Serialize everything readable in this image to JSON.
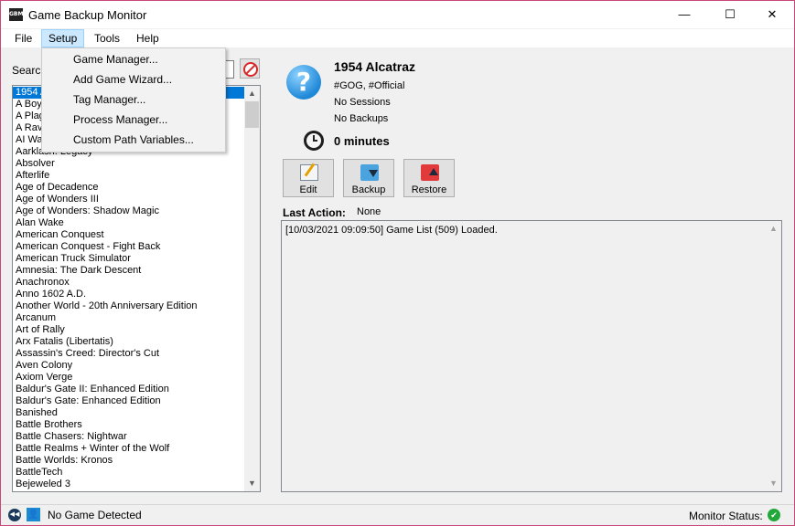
{
  "window": {
    "app_icon_text": "GBM",
    "title": "Game Backup Monitor",
    "minimize_glyph": "—",
    "maximize_glyph": "☐",
    "close_glyph": "✕"
  },
  "menu": {
    "file": "File",
    "setup": "Setup",
    "tools": "Tools",
    "help": "Help"
  },
  "setup_menu": {
    "items": [
      "Game Manager...",
      "Add Game Wizard...",
      "Tag Manager...",
      "Process Manager...",
      "Custom Path Variables..."
    ]
  },
  "search": {
    "label": "Search",
    "value": ""
  },
  "game_list": {
    "items": [
      "1954 Alcatraz",
      "A Boy",
      "A Plag",
      "A Rav",
      "AI Wa",
      "Aarklash: Legacy",
      "Absolver",
      "Afterlife",
      "Age of Decadence",
      "Age of Wonders III",
      "Age of Wonders: Shadow Magic",
      "Alan Wake",
      "American Conquest",
      "American Conquest - Fight Back",
      "American Truck Simulator",
      "Amnesia: The Dark Descent",
      "Anachronox",
      "Anno 1602 A.D.",
      "Another World - 20th Anniversary Edition",
      "Arcanum",
      "Art of Rally",
      "Arx Fatalis (Libertatis)",
      "Assassin's Creed: Director's Cut",
      "Aven Colony",
      "Axiom Verge",
      "Baldur's Gate II: Enhanced Edition",
      "Baldur's Gate: Enhanced Edition",
      "Banished",
      "Battle Brothers",
      "Battle Chasers: Nightwar",
      "Battle Realms + Winter of the Wolf",
      "Battle Worlds: Kronos",
      "BattleTech",
      "Bejeweled 3"
    ],
    "selected_index": 0
  },
  "game_details": {
    "icon_glyph": "?",
    "title": "1954 Alcatraz",
    "tags": "#GOG, #Official",
    "sessions": "No Sessions",
    "backups": "No Backups",
    "playtime": "0 minutes"
  },
  "actions": {
    "edit": "Edit",
    "backup": "Backup",
    "restore": "Restore"
  },
  "last_action": {
    "label": "Last Action:",
    "value": "None"
  },
  "log": {
    "lines": [
      "[10/03/2021 09:09:50] Game List (509) Loaded."
    ]
  },
  "status_bar": {
    "game_status": "No Game Detected",
    "monitor_label": "Monitor Status:",
    "monitor_ok_glyph": "✔"
  },
  "colors": {
    "selection": "#0078d7",
    "menu_highlight": "#cce8ff",
    "window_border": "#c8487a",
    "monitor_ok": "#22a83a"
  }
}
